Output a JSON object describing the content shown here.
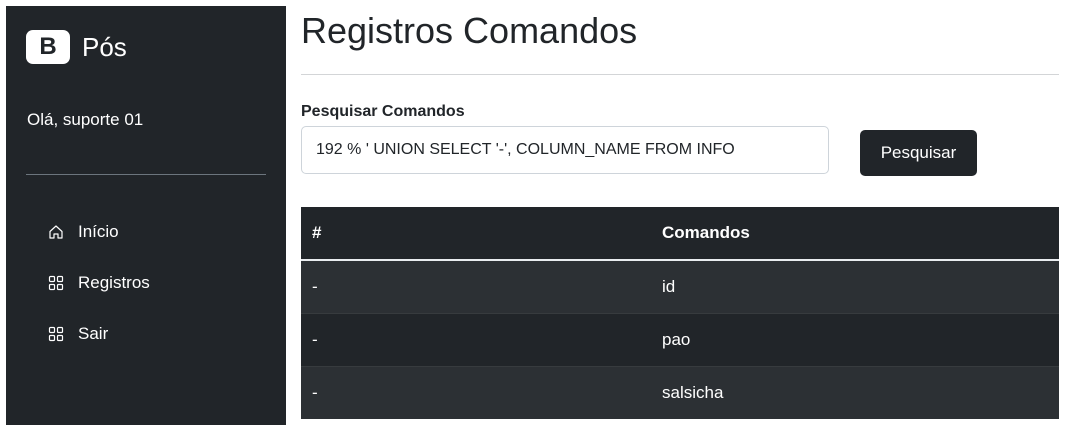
{
  "sidebar": {
    "brand": {
      "logo_letter": "B",
      "name": "Pós"
    },
    "greeting": "Olá, suporte 01",
    "items": [
      {
        "label": "Início",
        "icon": "house-icon"
      },
      {
        "label": "Registros",
        "icon": "grid-icon"
      },
      {
        "label": "Sair",
        "icon": "grid-icon"
      }
    ]
  },
  "main": {
    "title": "Registros Comandos",
    "search": {
      "label": "Pesquisar Comandos",
      "value": "192 % ' UNION SELECT '-', COLUMN_NAME FROM INFO",
      "button": "Pesquisar"
    },
    "table": {
      "headers": [
        "#",
        "Comandos"
      ],
      "rows": [
        [
          "-",
          "id"
        ],
        [
          "-",
          "pao"
        ],
        [
          "-",
          "salsicha"
        ]
      ]
    }
  },
  "colors": {
    "sidebar_bg": "#212529",
    "table_bg": "#212529",
    "table_stripe": "#2c3034",
    "button_bg": "#212529"
  }
}
